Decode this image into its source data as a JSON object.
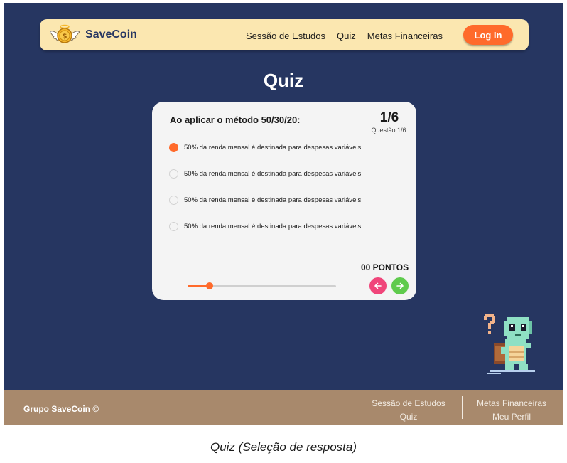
{
  "navbar": {
    "brand": "SaveCoin",
    "links": [
      "Sessão de Estudos",
      "Quiz",
      "Metas Financeiras"
    ],
    "login_label": "Log In"
  },
  "page": {
    "title": "Quiz"
  },
  "quiz": {
    "question": "Ao aplicar o método 50/30/20:",
    "counter": "1/6",
    "counter_sub": "Questão 1/6",
    "options": [
      {
        "text": "50% da renda mensal é destinada para despesas variáveis",
        "selected": true
      },
      {
        "text": "50% da renda mensal é destinada para despesas variáveis",
        "selected": false
      },
      {
        "text": "50% da renda mensal é destinada para despesas variáveis",
        "selected": false
      },
      {
        "text": "50% da renda mensal é destinada para despesas variáveis",
        "selected": false
      }
    ],
    "points": "00 PONTOS",
    "progress": 0.15
  },
  "footer": {
    "brand": "Grupo SaveCoin ©",
    "col1": [
      "Sessão de Estudos",
      "Quiz"
    ],
    "col2": [
      "Metas Financeiras",
      "Meu Perfil"
    ]
  },
  "caption": "Quiz (Seleção de resposta)",
  "colors": {
    "background": "#263661",
    "navbar": "#fbe7b0",
    "accent": "#ff6a2b",
    "prev": "#f0457a",
    "next": "#5fcb4d",
    "footer": "#a8896c"
  },
  "icons": [
    "winged-coin-icon",
    "arrow-left-icon",
    "arrow-right-icon",
    "turtle-mascot-icon"
  ]
}
